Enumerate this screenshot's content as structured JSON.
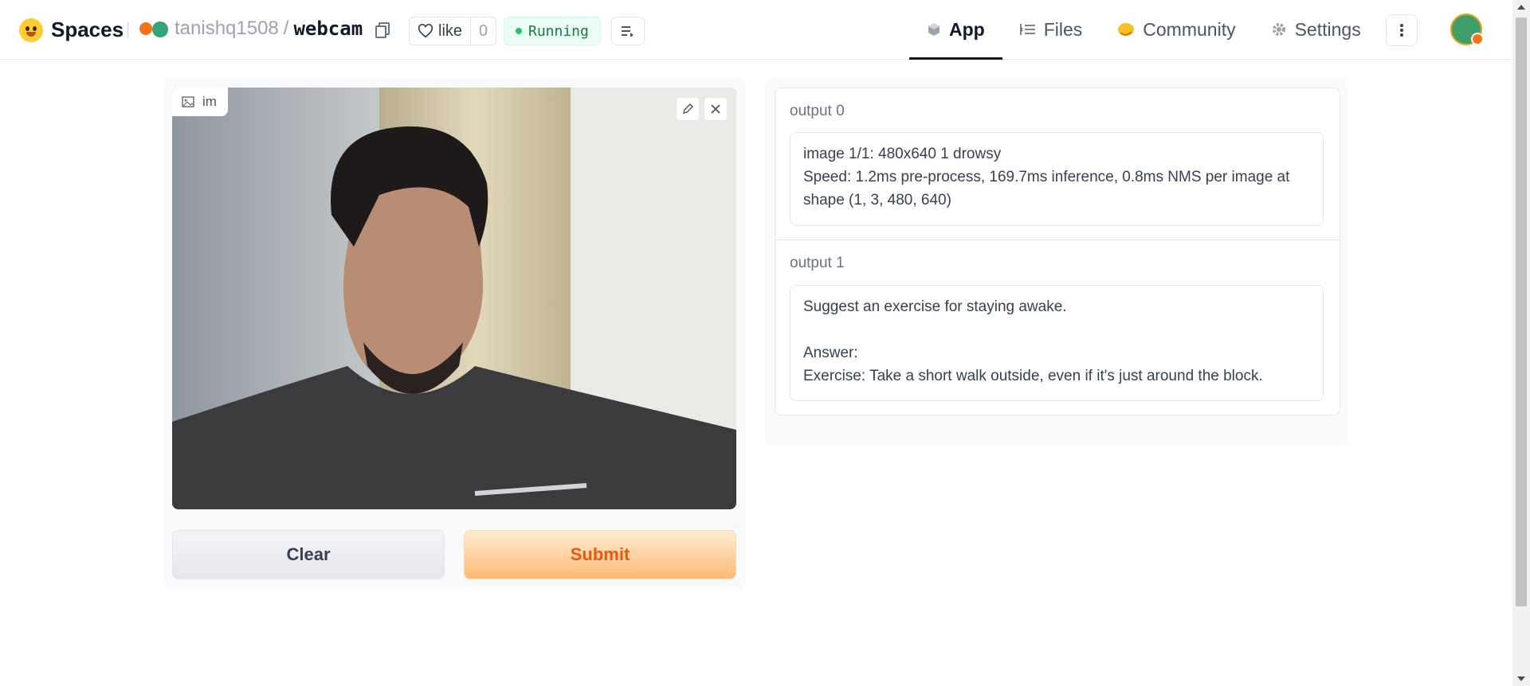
{
  "header": {
    "brand": "Spaces",
    "owner": "tanishq1508",
    "separator": "/",
    "repo": "webcam",
    "like_label": "like",
    "like_count": "0",
    "status": "Running",
    "nav": [
      {
        "label": "App",
        "icon": "cube-icon",
        "active": true
      },
      {
        "label": "Files",
        "icon": "files-icon",
        "active": false
      },
      {
        "label": "Community",
        "icon": "community-icon",
        "active": false
      },
      {
        "label": "Settings",
        "icon": "gear-icon",
        "active": false
      }
    ]
  },
  "input": {
    "image_label": "im",
    "clear_label": "Clear",
    "submit_label": "Submit"
  },
  "outputs": [
    {
      "label": "output 0",
      "text": "image 1/1: 480x640 1 drowsy\nSpeed: 1.2ms pre-process, 169.7ms inference, 0.8ms NMS per image at shape (1, 3, 480, 640)"
    },
    {
      "label": "output 1",
      "text": "Suggest an exercise for staying awake.\n\nAnswer:\nExercise: Take a short walk outside, even if it's just around the block."
    }
  ],
  "colors": {
    "accent": "#ea580c",
    "status_green": "#22c55e",
    "submit_gradient_end": "#fdba74"
  }
}
